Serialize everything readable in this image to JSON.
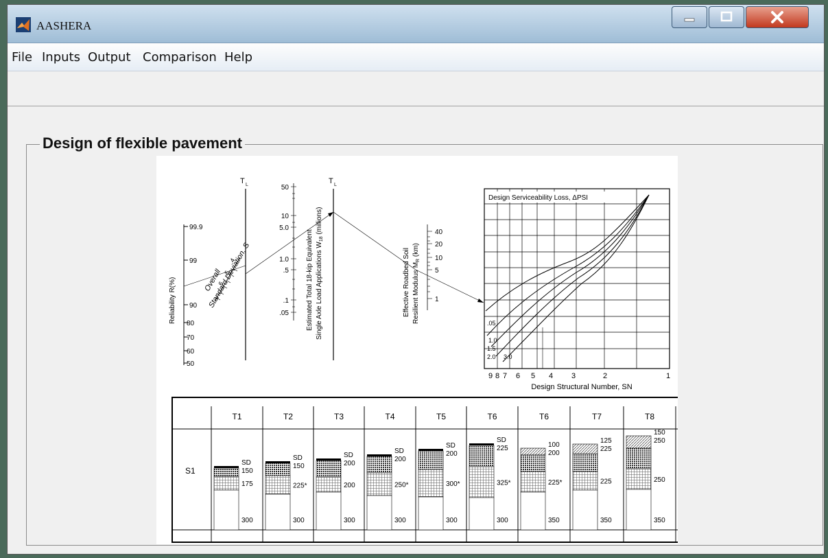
{
  "window": {
    "title": "AASHERA"
  },
  "menu": [
    "File",
    "Inputs",
    "Output",
    "Comparison",
    "Help"
  ],
  "panel": {
    "title": "Design of flexible pavement"
  },
  "nomograph": {
    "tl_label": "T",
    "tl_sub": "L",
    "reliability_label": "Reliability R(%)",
    "reliability_ticks": [
      "99.9",
      "99",
      "90",
      "80",
      "70",
      "60",
      "50"
    ],
    "sd_label_1": "Overall",
    "sd_label_2": "Standard Deviation, S",
    "sd_label_sub": "0",
    "sd_ticks": [
      ".4",
      ".5",
      ".6"
    ],
    "w18_label_1": "Estimated Total 18-kip Equivalent",
    "w18_label_2": "Single Axle Load Applications W",
    "w18_label_sub": "18",
    "w18_label_end": " (millions)",
    "w18_ticks": [
      "50",
      "10",
      "5.0",
      "1.0",
      ".5",
      ".1",
      ".05"
    ],
    "mr_label_1": "Effective Roadbed Soil",
    "mr_label_2": "Resilient Modulus M",
    "mr_label_sub": "R",
    "mr_label_end": " (km)",
    "mr_ticks": [
      "40",
      "20",
      "10",
      "5",
      "1"
    ],
    "chart_title": "Design Serviceability Loss, ΔPSI",
    "curve_labels": [
      ".05",
      "1.0",
      "1.5",
      "2.0",
      "3.0"
    ],
    "sn_ticks": [
      "9",
      "8",
      "7",
      "6",
      "5",
      "4",
      "3",
      "2",
      "1"
    ],
    "sn_label": "Design Structural Number, SN"
  },
  "thickness_table": {
    "headers": [
      "T1",
      "T2",
      "T3",
      "T4",
      "T5",
      "T6",
      "T6",
      "T7",
      "T8"
    ],
    "row_label": "S1",
    "columns": [
      {
        "top": "SD",
        "l1": "150",
        "l2": "175",
        "l3": "300"
      },
      {
        "top": "SD",
        "l1": "150",
        "l2": "225*",
        "l3": "300"
      },
      {
        "top": "SD",
        "l1": "200",
        "l2": "200",
        "l3": "300"
      },
      {
        "top": "SD",
        "l1": "200",
        "l2": "250*",
        "l3": "300"
      },
      {
        "top": "SD",
        "l1": "200",
        "l2": "300*",
        "l3": "300"
      },
      {
        "top": "SD",
        "l1": "225",
        "l2": "325*",
        "l3": "300"
      },
      {
        "top": "100",
        "l1": "200",
        "l2": "225*",
        "l3": "350"
      },
      {
        "top": "125",
        "l1": "225",
        "l2": "225",
        "l3": "350"
      },
      {
        "top": "150",
        "l1": "250",
        "l2": "250",
        "l3": "350"
      }
    ]
  }
}
